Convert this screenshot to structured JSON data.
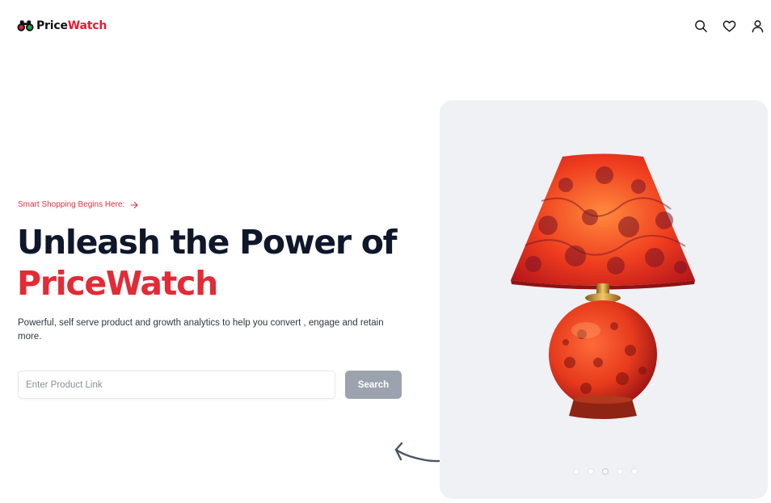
{
  "navbar": {
    "brand_part1": "Price",
    "brand_part2": "Watch",
    "icons": [
      "binoculars-icon",
      "search-icon",
      "heart-icon",
      "user-icon"
    ]
  },
  "hero": {
    "eyebrow": "Smart Shopping Begins Here:",
    "headline_line1": "Unleash the Power of",
    "headline_line2": "PriceWatch",
    "description": "Powerful, self serve product and growth analytics to help you convert , engage and retain more.",
    "search": {
      "placeholder": "Enter Product Link",
      "value": "",
      "button_label": "Search"
    }
  },
  "carousel": {
    "slide_count": 5,
    "active_index": 2
  },
  "colors": {
    "brand_red": "#e32b36",
    "heading": "#0f172a",
    "button_disabled": "#9ca3af",
    "card_bg": "#f0f1f5"
  }
}
